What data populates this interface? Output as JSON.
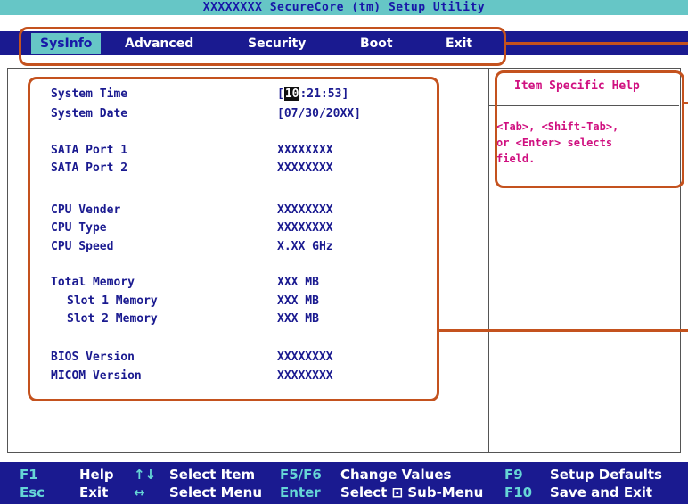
{
  "app_title": "XXXXXXXX SecureCore (tm) Setup Utility",
  "menu": [
    {
      "label": "SysInfo",
      "active": true
    },
    {
      "label": "Advanced",
      "active": false
    },
    {
      "label": "Security",
      "active": false
    },
    {
      "label": "Boot",
      "active": false
    },
    {
      "label": "Exit",
      "active": false
    }
  ],
  "sysinfo": {
    "system_time": {
      "label": "System Time",
      "bracket_open": "[",
      "cursor_value": "10",
      "rest": ":21:53]"
    },
    "system_date": {
      "label": "System Date",
      "value": "[07/30/20XX]"
    },
    "sata_port_1": {
      "label": "SATA Port 1",
      "value": "XXXXXXXX"
    },
    "sata_port_2": {
      "label": "SATA Port 2",
      "value": "XXXXXXXX"
    },
    "cpu_vender": {
      "label": "CPU Vender",
      "value": "XXXXXXXX"
    },
    "cpu_type": {
      "label": "CPU Type",
      "value": "XXXXXXXX"
    },
    "cpu_speed": {
      "label": "CPU Speed",
      "value": "X.XX GHz"
    },
    "total_memory": {
      "label": "Total Memory",
      "value": "XXX MB"
    },
    "slot1_memory": {
      "label": "Slot 1 Memory",
      "value": "XXX MB"
    },
    "slot2_memory": {
      "label": "Slot 2 Memory",
      "value": "XXX MB"
    },
    "bios_version": {
      "label": "BIOS Version",
      "value": "XXXXXXXX"
    },
    "micom_version": {
      "label": "MICOM Version",
      "value": "XXXXXXXX"
    }
  },
  "help": {
    "title": "Item Specific Help",
    "text": "<Tab>, <Shift-Tab>,\nor <Enter> selects\nfield."
  },
  "footer": {
    "f1_key": "F1",
    "f1_desc": "Help",
    "arrows_ud": "↑↓",
    "select_item": "Select Item",
    "f5f6_key": "F5/F6",
    "change_values": "Change Values",
    "f9_key": "F9",
    "setup_defaults": "Setup Defaults",
    "esc_key": "Esc",
    "exit_desc": "Exit",
    "arrows_lr": "↔",
    "select_menu": "Select Menu",
    "enter_key": "Enter",
    "select_submenu": "Select ⊡ Sub-Menu",
    "f10_key": "F10",
    "save_exit": "Save and Exit"
  },
  "colors": {
    "menubar_bg": "#1a1a90",
    "title_bg": "#66c6c6",
    "help_text": "#d01080",
    "annotation": "#c4521e"
  }
}
